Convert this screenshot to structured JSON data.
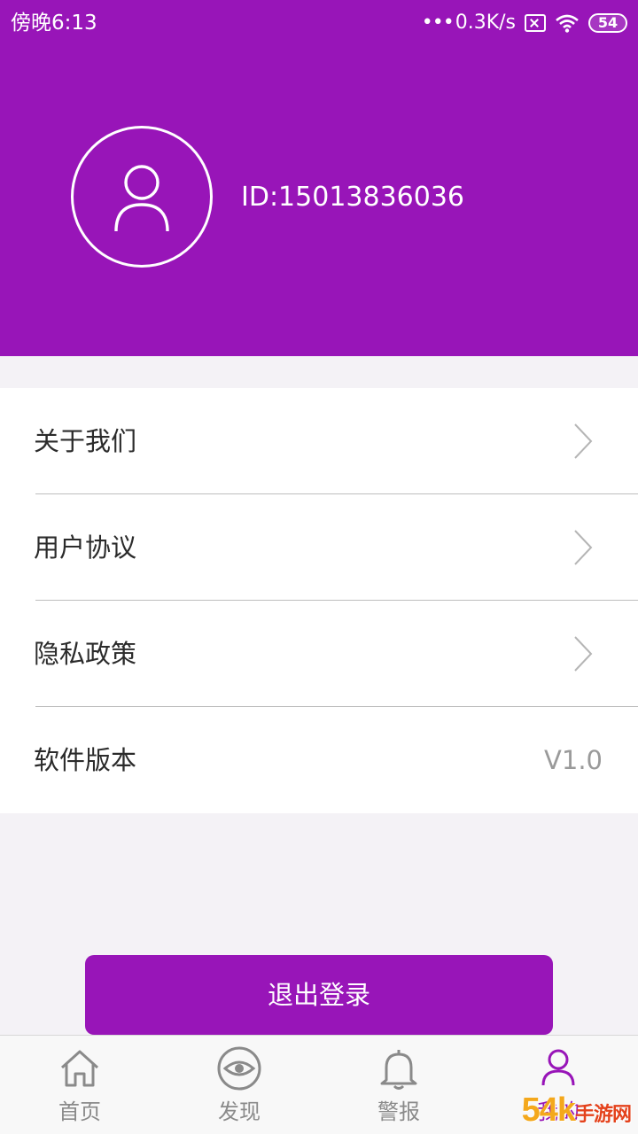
{
  "status_bar": {
    "time": "傍晚6:13",
    "dots": "•••",
    "net_speed": "0.3K/s",
    "battery": "54"
  },
  "profile": {
    "user_id": "ID:15013836036"
  },
  "menu": {
    "items": [
      {
        "label": "关于我们",
        "icon": "chevron-right-icon"
      },
      {
        "label": "用户协议",
        "icon": "chevron-right-icon"
      },
      {
        "label": "隐私政策",
        "icon": "chevron-right-icon"
      },
      {
        "label": "软件版本",
        "value": "V1.0"
      }
    ]
  },
  "logout": {
    "label": "退出登录"
  },
  "tabbar": {
    "tabs": [
      {
        "label": "首页",
        "icon": "home-icon"
      },
      {
        "label": "发现",
        "icon": "eye-icon"
      },
      {
        "label": "警报",
        "icon": "bell-icon"
      },
      {
        "label": "我的",
        "icon": "user-icon",
        "active": true
      }
    ]
  },
  "watermark": {
    "main": "54k",
    "sub": "手游网"
  },
  "colors": {
    "brand": "#9815b8",
    "background": "#f4f2f6",
    "inactive_tab": "#8a8a8a"
  }
}
